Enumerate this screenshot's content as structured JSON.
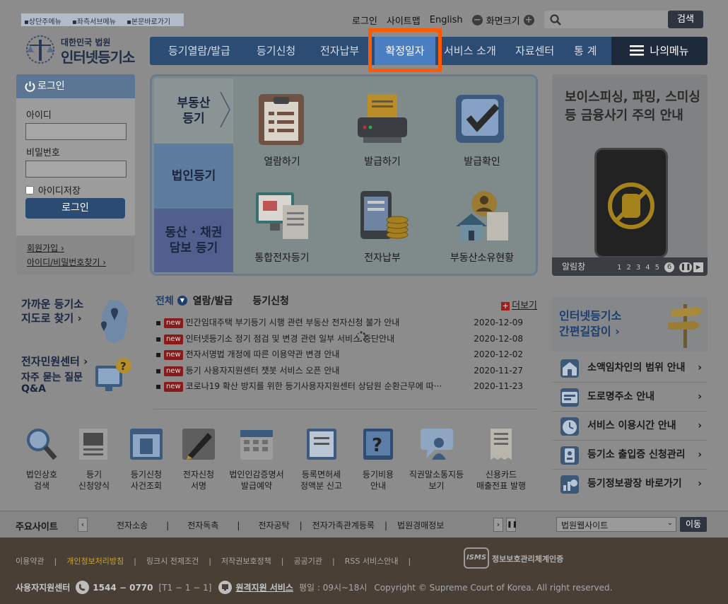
{
  "skip_links": [
    "상단주메뉴",
    "좌측서브메뉴",
    "본문바로가기"
  ],
  "top_nav": {
    "login": "로그인",
    "sitemap": "사이트맵",
    "english": "English",
    "font_size": "화면크기",
    "minus": "−",
    "plus": "+"
  },
  "search": {
    "placeholder": "",
    "button": "검색"
  },
  "logo": {
    "line1": "대한민국 법원",
    "line2": "인터넷등기소"
  },
  "main_menu": [
    {
      "label": "등기열람/발급"
    },
    {
      "label": "등기신청"
    },
    {
      "label": "전자납부"
    },
    {
      "label": "확정일자"
    },
    {
      "label": "서비스 소개"
    },
    {
      "label": "자료센터"
    },
    {
      "label": "통 계"
    }
  ],
  "my_menu": "나의메뉴",
  "login_box": {
    "title": "로그인",
    "id_label": "아이디",
    "pw_label": "비밀번호",
    "save_id": "아이디저장",
    "login_button": "로그인",
    "signup": "회원가입 ›",
    "find": "아이디/비밀번호찾기 ›"
  },
  "service_tabs": [
    {
      "label": "부동산\n등기"
    },
    {
      "label": "법인등기"
    },
    {
      "label": "동산 · 채권\n담보 등기"
    }
  ],
  "services": [
    {
      "label": "열람하기",
      "icon": "document-list-icon"
    },
    {
      "label": "발급하기",
      "icon": "printer-icon"
    },
    {
      "label": "발급확인",
      "icon": "check-icon"
    },
    {
      "label": "통합전자등기",
      "icon": "monitor-documents-icon"
    },
    {
      "label": "전자납부",
      "icon": "coins-icon"
    },
    {
      "label": "부동산소유현황",
      "icon": "house-person-icon"
    }
  ],
  "ad": {
    "title": "보이스피싱, 파밍, 스미싱\n등 금융사기 주의 안내",
    "bar_label": "알림창",
    "pages": [
      "1",
      "2",
      "3",
      "4",
      "5",
      "6"
    ],
    "active_page": "6"
  },
  "left_links": {
    "map_title": "가까운 등기소\n지도로 찾기 ›",
    "civil_center": "전자민원센터 ›",
    "faq": "자주 묻는 질문\nQ&A"
  },
  "news": {
    "tabs": [
      "전체",
      "열람/발급",
      "등기신청"
    ],
    "more": "더보기",
    "new_badge": "new",
    "items": [
      {
        "title": "민간임대주택 부기등기 시행 관련 부동산 전자신청 불가 안내",
        "date": "2020-12-09"
      },
      {
        "title": "인터넷등기소 정기 점검 및 변경 관련 일부 서비스 중단안내",
        "date": "2020-12-08"
      },
      {
        "title": "전자서명법 개정에 따른 이용약관 변경 안내",
        "date": "2020-12-02"
      },
      {
        "title": "등기 사용자지원센터 챗봇 서비스 오픈 안내",
        "date": "2020-11-27"
      },
      {
        "title": "코로나19 확산 방지를 위한 등기사용자지원센터 상담원 순환근무에 따···",
        "date": "2020-11-23"
      }
    ]
  },
  "quick_icons": [
    {
      "label": "법인상호\n검색",
      "icon": "magnifier-icon"
    },
    {
      "label": "등기\n신청양식",
      "icon": "form-icon"
    },
    {
      "label": "등기신청\n사건조회",
      "icon": "case-search-icon"
    },
    {
      "label": "전자신청\n서명",
      "icon": "pen-icon"
    },
    {
      "label": "법인인감증명서\n발급예약",
      "icon": "calendar-icon"
    },
    {
      "label": "등록면허세\n정액분 신고",
      "icon": "tax-form-icon"
    },
    {
      "label": "등기비용\n안내",
      "icon": "question-icon"
    },
    {
      "label": "직권말소통지등\n보기",
      "icon": "notice-icon"
    },
    {
      "label": "신용카드\n매출전표 발행",
      "icon": "receipt-icon"
    }
  ],
  "right_panel": {
    "guide_title": "인터넷등기소\n간편길잡이 ›",
    "links": [
      {
        "label": "소액임차인의 범위 안내",
        "icon": "house-icon"
      },
      {
        "label": "도로명주소 안내",
        "icon": "road-sign-icon"
      },
      {
        "label": "서비스 이용시간 안내",
        "icon": "clock-icon"
      },
      {
        "label": "등기소 출입증 신청관리",
        "icon": "badge-icon"
      },
      {
        "label": "등기정보광장 바로가기",
        "icon": "chart-icon"
      }
    ]
  },
  "sites_bar": {
    "label": "주요사이트",
    "sites": [
      "전자소송",
      "전자독촉",
      "전자공탁",
      "전자가족관계등록",
      "법원경매정보"
    ],
    "select_value": "법원웹사이트",
    "go_button": "이동"
  },
  "footer": {
    "links": [
      "이용약관",
      "개인정보처리방침",
      "링크시 전제조건",
      "저작권보호정책",
      "공공기관",
      "RSS 서비스안내"
    ],
    "sms_badge": "ISMS",
    "cert": "정보보호관리체계인증",
    "support_center": "사용자지원센터",
    "phone": "1544 − 0770",
    "phone_ext": "[T1 − 1 − 1]",
    "remote": "원격지원 서비스",
    "hours": "평일 : 09시~18시",
    "copyright": "Copyright © Supreme Court of Korea. All right reserved."
  },
  "colors": {
    "highlight": "#ff5a00",
    "menu_bg": "#2d4c73",
    "active_menu": "#4a7fc4"
  }
}
